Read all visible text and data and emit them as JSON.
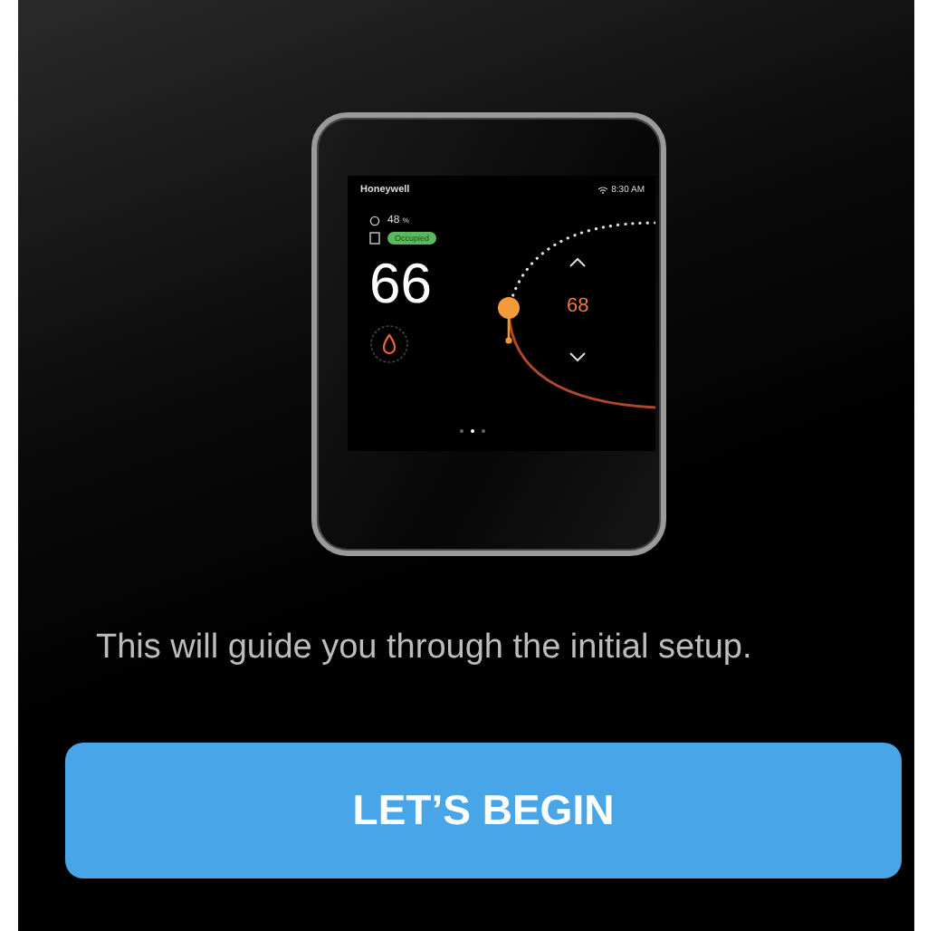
{
  "device": {
    "brand": "Honeywell",
    "time": "8:30 AM",
    "humidity": "48",
    "humidity_unit": "%",
    "occupancy": "Occupied",
    "temperature": "66",
    "setpoint": "68",
    "pages": [
      {
        "selected": false
      },
      {
        "selected": true
      },
      {
        "selected": false
      }
    ]
  },
  "message": "This will guide you through the initial setup.",
  "button": "LET’S BEGIN"
}
